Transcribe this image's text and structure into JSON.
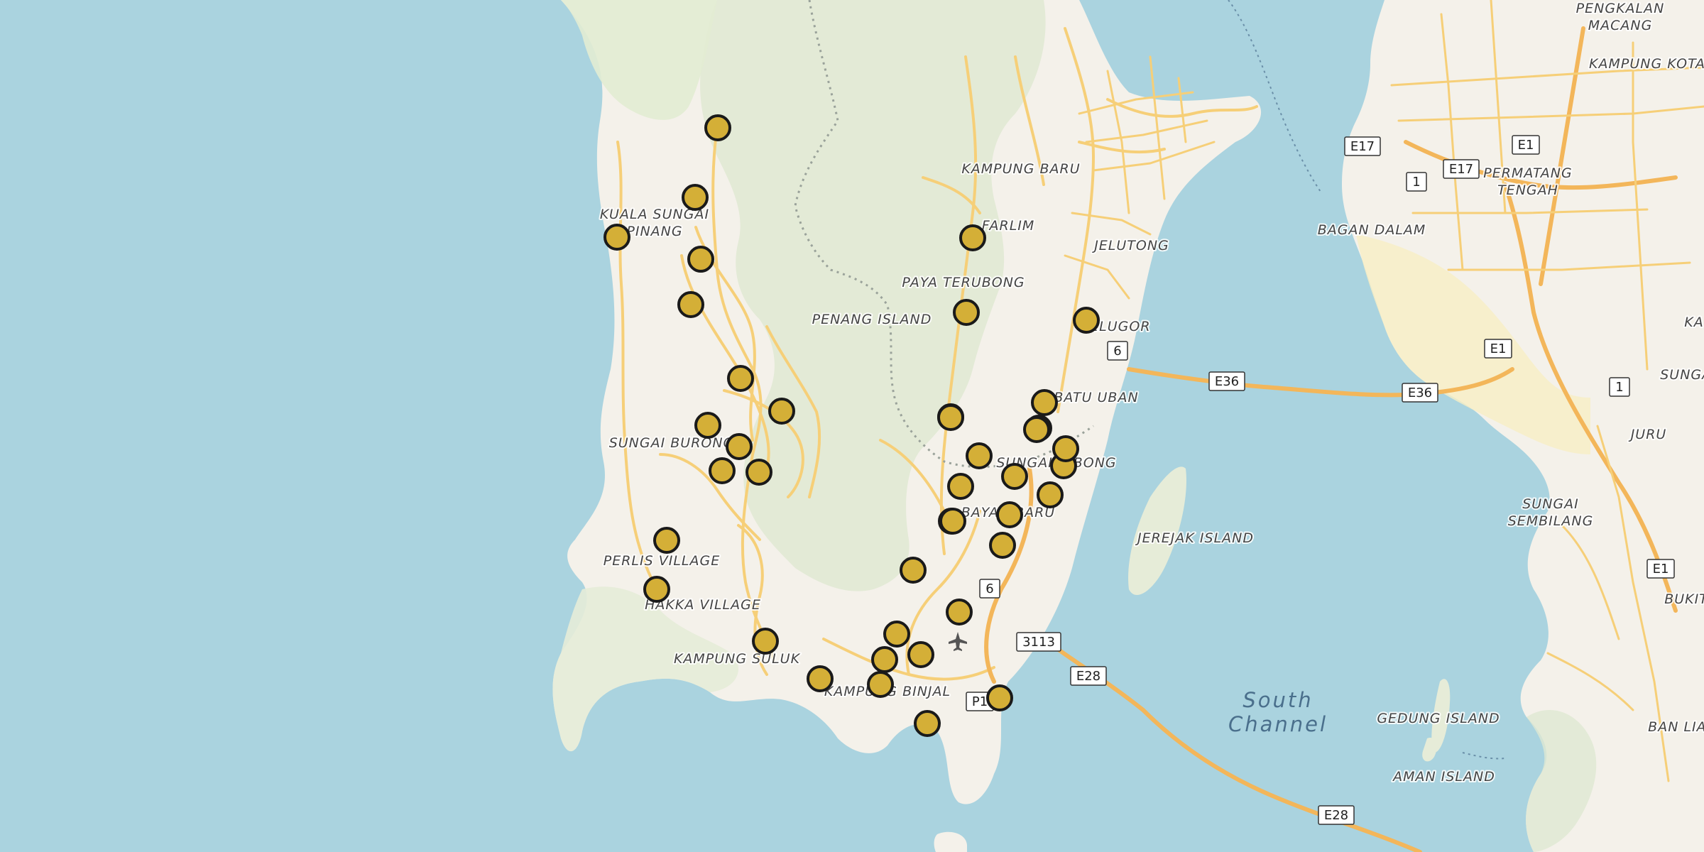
{
  "map": {
    "place_labels": [
      "PENGKALAN",
      "MACANG",
      "KAMPUNG KOTA",
      "KAMPUNG BARU",
      "PERMATANG",
      "TENGAH",
      "KUALA SUNGAI",
      "PINANG",
      "FARLIM",
      "BAGAN DALAM",
      "JELUTONG",
      "PAYA TERUBONG",
      "PENANG ISLAND",
      "GELUGOR",
      "BATU UBAN",
      "SUNGAI BURONG",
      "SUNGAI NIBONG",
      "BAYAN BARU",
      "JEREJAK ISLAND",
      "PERLIS VILLAGE",
      "HAKKA VILLAGE",
      "KAMPUNG SULUK",
      "KAMPUNG BINJAL",
      "GEDUNG ISLAND",
      "AMAN ISLAND",
      "JURU",
      "SUNGAI",
      "SEMBILANG",
      "BUKIT",
      "BAN LIAN",
      "SUNGAI",
      "KA"
    ],
    "water_labels": [
      "South",
      "Channel"
    ],
    "road_shields": [
      "E17",
      "E1",
      "1",
      "E17",
      "6",
      "E36",
      "E36",
      "E1",
      "1",
      "6",
      "3113",
      "E28",
      "P1",
      "E28",
      "E1"
    ],
    "marker_color": "#d4af37",
    "marker_count": 41
  }
}
